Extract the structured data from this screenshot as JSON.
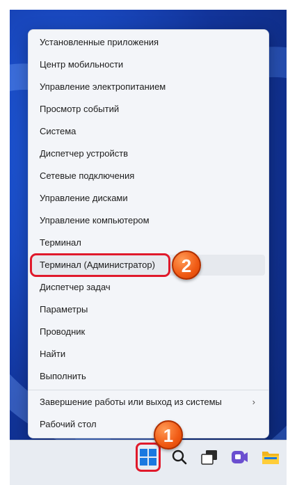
{
  "menu": {
    "items": [
      {
        "label": "Установленные приложения"
      },
      {
        "label": "Центр мобильности"
      },
      {
        "label": "Управление электропитанием"
      },
      {
        "label": "Просмотр событий"
      },
      {
        "label": "Система"
      },
      {
        "label": "Диспетчер устройств"
      },
      {
        "label": "Сетевые подключения"
      },
      {
        "label": "Управление дисками"
      },
      {
        "label": "Управление компьютером"
      },
      {
        "label": "Терминал"
      },
      {
        "label": "Терминал (Администратор)"
      },
      {
        "label": "Диспетчер задач"
      },
      {
        "label": "Параметры"
      },
      {
        "label": "Проводник"
      },
      {
        "label": "Найти"
      },
      {
        "label": "Выполнить"
      },
      {
        "label": "Завершение работы или выход из системы",
        "submenu_indicator": "›"
      },
      {
        "label": "Рабочий стол"
      }
    ]
  },
  "annotations": {
    "badge_1": "1",
    "badge_2": "2",
    "color": "#e0192b",
    "badge_color": "#f05a14"
  },
  "taskbar": {
    "icons": [
      "windows-start-icon",
      "search-icon",
      "task-view-icon",
      "chat-icon",
      "file-explorer-icon"
    ]
  },
  "colors": {
    "wallpaper": "#1a4bc4",
    "menu_bg": "#f3f5f9",
    "highlight": "#e6e9ee"
  }
}
